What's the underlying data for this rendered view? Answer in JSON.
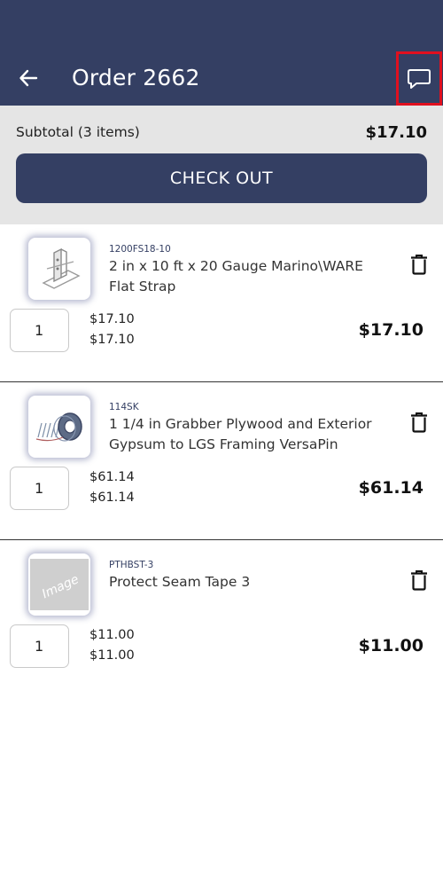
{
  "header": {
    "title": "Order 2662",
    "back_icon": "arrow-left-icon",
    "chat_icon": "chat-bubble-icon",
    "bg_color": "#343f63",
    "highlight_color": "#e0101f"
  },
  "summary": {
    "subtotal_label": "Subtotal (3 items)",
    "subtotal_value": "$17.10",
    "checkout_label": "CHECK OUT"
  },
  "items": [
    {
      "sku": "1200FS18-10",
      "name": "2 in x 10 ft x 20 Gauge Marino\\WARE Flat Strap",
      "quantity": "1",
      "unit_price": "$17.10",
      "extended_price": "$17.10",
      "line_total": "$17.10",
      "image": "flat-strap-image"
    },
    {
      "sku": "114SK",
      "name": "1 1/4 in Grabber Plywood and Exterior Gypsum to LGS Framing VersaPin",
      "quantity": "1",
      "unit_price": "$61.14",
      "extended_price": "$61.14",
      "line_total": "$61.14",
      "image": "screw-coil-image"
    },
    {
      "sku": "PTHBST-3",
      "name": "Protect Seam Tape 3",
      "quantity": "1",
      "unit_price": "$11.00",
      "extended_price": "$11.00",
      "line_total": "$11.00",
      "image": "placeholder-image",
      "placeholder_text": "Image"
    }
  ]
}
